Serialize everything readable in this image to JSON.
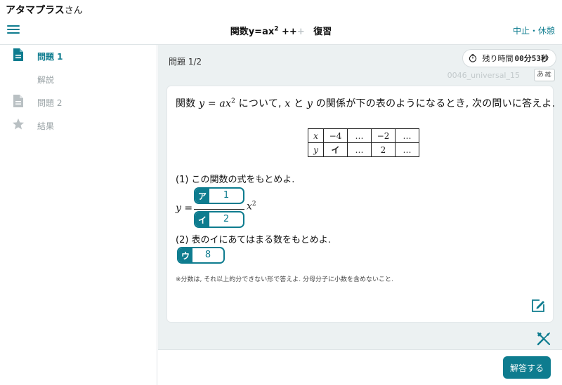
{
  "header": {
    "user_name": "アタマプラス",
    "user_suffix": "さん",
    "title_main": "関数y=ax",
    "title_sup": "2",
    "title_plus_on": "++",
    "title_plus_off": "+",
    "title_mode": "復習",
    "quit_label": "中止・休憩"
  },
  "sidebar": {
    "items": [
      {
        "label": "問題 1",
        "icon": "document-icon",
        "active": true
      },
      {
        "label": "解説",
        "icon": "",
        "active": false
      },
      {
        "label": "問題 2",
        "icon": "document-icon",
        "active": false
      },
      {
        "label": "結果",
        "icon": "star-icon",
        "active": false
      }
    ]
  },
  "main": {
    "question_number": "問題 1/2",
    "timer_label": "残り時間",
    "timer_value": "00分53秒",
    "problem_id": "0046_universal_15",
    "font_toggle_label": "あぁ"
  },
  "question": {
    "t1": "関数",
    "t_y": "y",
    "t_eq": " = ",
    "t_ax": "ax",
    "t_sup": "2",
    "t2": " について, ",
    "t_x": "x",
    "t3": " と ",
    "t_y2": "y",
    "t4": " の関係が下の表のようになるとき, 次の問いに答えよ.",
    "table": {
      "row_x": {
        "head": "x",
        "cells": [
          "−4",
          "…",
          "−2",
          "…"
        ]
      },
      "row_y": {
        "head": "y",
        "cells": [
          "イ",
          "…",
          "2",
          "…"
        ]
      }
    },
    "sub1": "(1) この関数の式をもとめよ.",
    "sub2": "(2) 表のイにあてはまる数をもとめよ.",
    "formula_y": "y",
    "formula_eq": " =",
    "formula_x": "x",
    "formula_sup": "2",
    "answers": {
      "a": {
        "tag": "ア",
        "value": "1"
      },
      "i": {
        "tag": "イ",
        "value": "2"
      },
      "u": {
        "tag": "ウ",
        "value": "8"
      }
    },
    "note": "※分数は, それ以上約分できない形で答えよ. 分母分子に小数を含めないこと."
  },
  "footer": {
    "submit_label": "解答する"
  },
  "colors": {
    "accent": "#0e7c8f",
    "background": "#ecf1f2"
  }
}
